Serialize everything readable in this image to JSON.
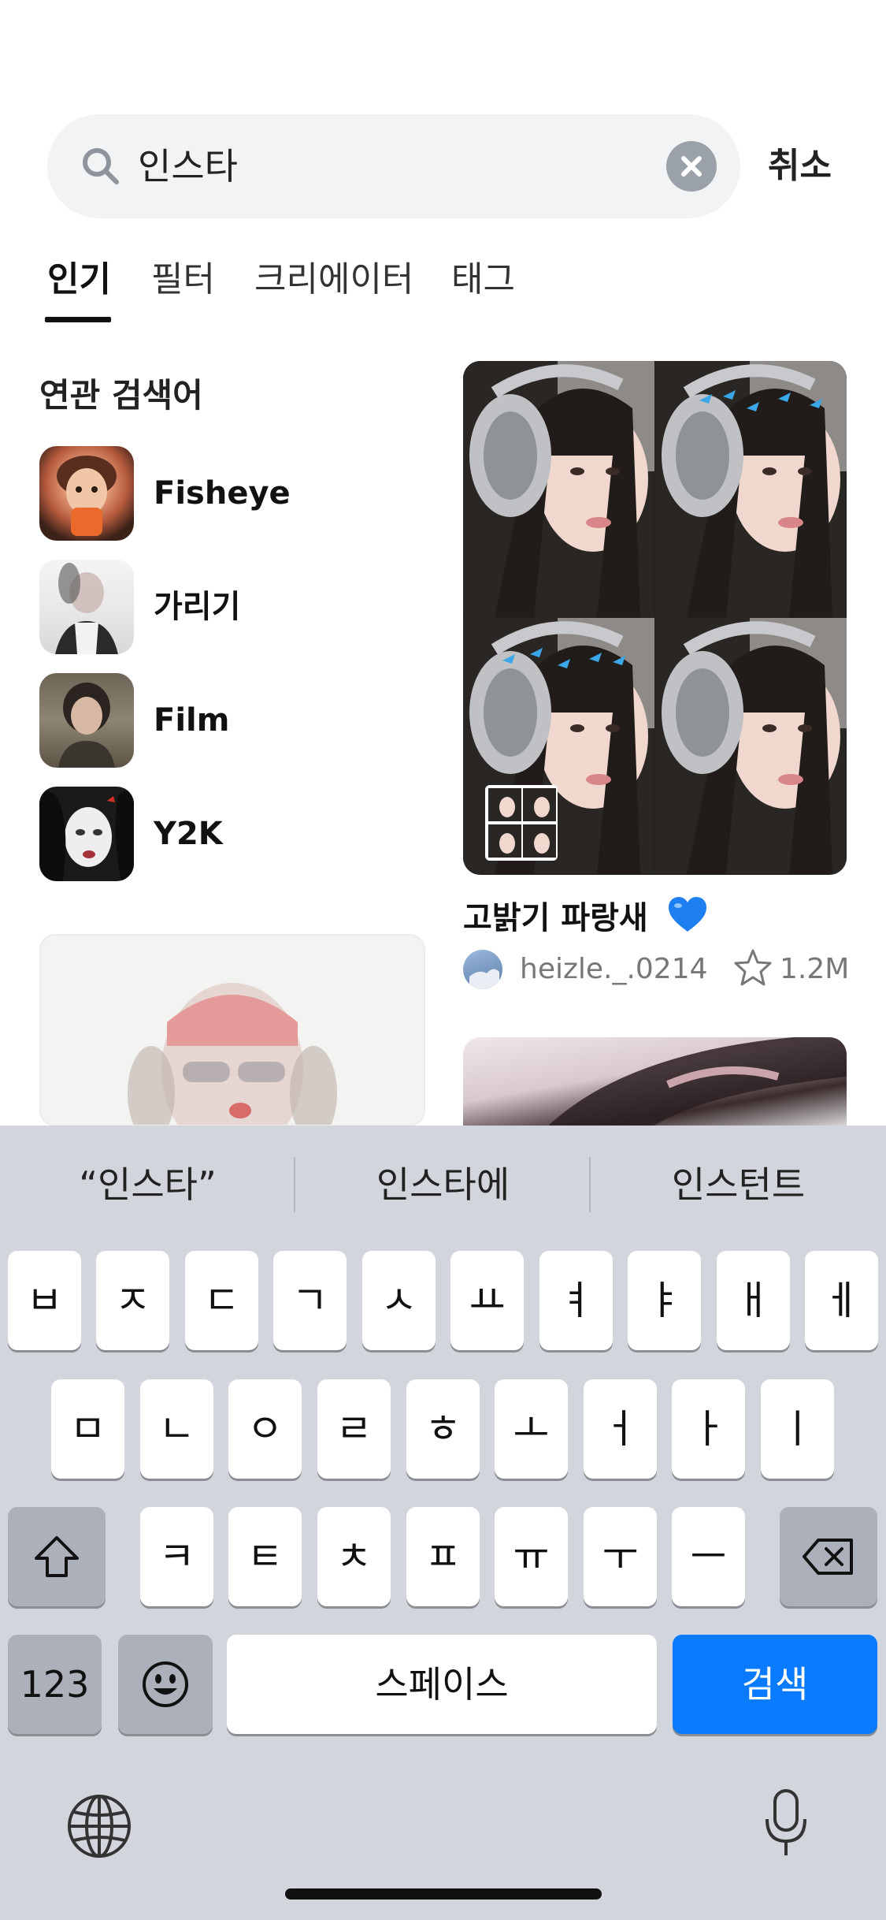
{
  "search": {
    "query": "인스타",
    "cancel_label": "취소"
  },
  "tabs": [
    {
      "label": "인기",
      "active": true
    },
    {
      "label": "필터",
      "active": false
    },
    {
      "label": "크리에이터",
      "active": false
    },
    {
      "label": "태그",
      "active": false
    }
  ],
  "related": {
    "title": "연관 검색어",
    "items": [
      {
        "label": "Fisheye"
      },
      {
        "label": "가리기"
      },
      {
        "label": "Film"
      },
      {
        "label": "Y2K"
      }
    ]
  },
  "feed": {
    "main_card": {
      "title": "고밝기 파랑새",
      "emoji": "blue-heart-icon",
      "author": "heizle._.0214",
      "likes": "1.2M"
    }
  },
  "keyboard": {
    "suggestions": [
      "“인스타”",
      "인스타에",
      "인스턴트"
    ],
    "row1": [
      "ㅂ",
      "ㅈ",
      "ㄷ",
      "ㄱ",
      "ㅅ",
      "ㅛ",
      "ㅕ",
      "ㅑ",
      "ㅐ",
      "ㅔ"
    ],
    "row2": [
      "ㅁ",
      "ㄴ",
      "ㅇ",
      "ㄹ",
      "ㅎ",
      "ㅗ",
      "ㅓ",
      "ㅏ",
      "ㅣ"
    ],
    "row3": [
      "ㅋ",
      "ㅌ",
      "ㅊ",
      "ㅍ",
      "ㅠ",
      "ㅜ",
      "ㅡ"
    ],
    "numbers_label": "123",
    "space_label": "스페이스",
    "search_label": "검색"
  },
  "colors": {
    "accent": "#0a7aff",
    "keyboard_bg": "#d2d5db",
    "search_bg": "#f1f3f5"
  }
}
